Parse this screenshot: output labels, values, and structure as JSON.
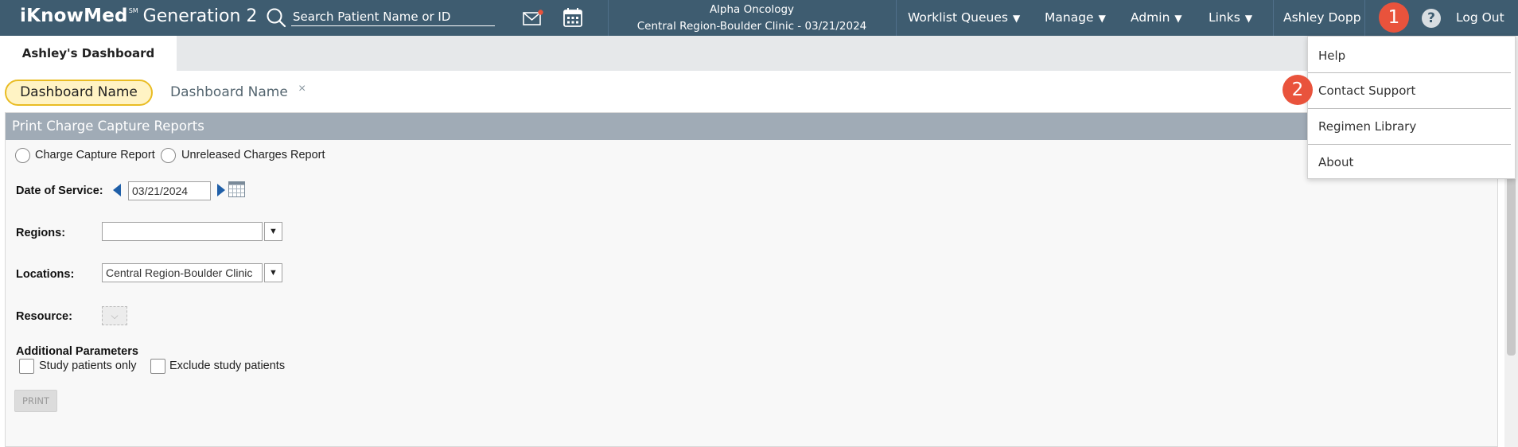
{
  "topbar": {
    "logo_brand": "iKnowMed",
    "logo_sm": "SM",
    "logo_generation": "Generation 2",
    "search_placeholder": "Search Patient Name or ID",
    "org_name": "Alpha Oncology",
    "org_location_date": "Central Region-Boulder Clinic - 03/21/2024",
    "nav": [
      {
        "label": "Worklist Queues"
      },
      {
        "label": "Manage"
      },
      {
        "label": "Admin"
      },
      {
        "label": "Links"
      }
    ],
    "user_name": "Ashley Dopp",
    "logout_label": "Log Out",
    "help_icon_glyph": "?"
  },
  "badges": {
    "step1": "1",
    "step2": "2"
  },
  "tabs": {
    "active_label": "Ashley's Dashboard"
  },
  "dashboards": {
    "active_label": "Dashboard Name",
    "inactive_label": "Dashboard Name",
    "close_glyph": "×"
  },
  "panel": {
    "title": "Print Charge Capture Reports",
    "report_options": [
      {
        "label": "Charge Capture Report"
      },
      {
        "label": "Unreleased Charges Report"
      }
    ],
    "date_of_service_label": "Date of Service:",
    "date_value": "03/21/2024",
    "regions_label": "Regions:",
    "regions_value": "",
    "locations_label": "Locations:",
    "locations_value": "Central Region-Boulder Clinic",
    "resource_label": "Resource:",
    "additional_params_label": "Additional Parameters",
    "study_only_label": "Study patients only",
    "exclude_study_label": "Exclude study patients",
    "print_label": "PRINT"
  },
  "menu": {
    "items": [
      {
        "label": "Help"
      },
      {
        "label": "Contact Support"
      },
      {
        "label": "Regimen Library"
      },
      {
        "label": "About"
      }
    ]
  },
  "colors": {
    "topbar_bg": "#3e5c70",
    "badge_red": "#e9533c",
    "pill_yellow_border": "#e9bc23",
    "pill_yellow_bg": "#fff3c4",
    "panel_header_bg": "#a0abb6",
    "arrow_blue": "#1f5fa8"
  },
  "icons": [
    "search-icon",
    "mail-icon",
    "calendar-icon",
    "help-icon",
    "chevron-down-icon",
    "arrow-left-icon",
    "arrow-right-icon",
    "calendar-picker-icon"
  ]
}
